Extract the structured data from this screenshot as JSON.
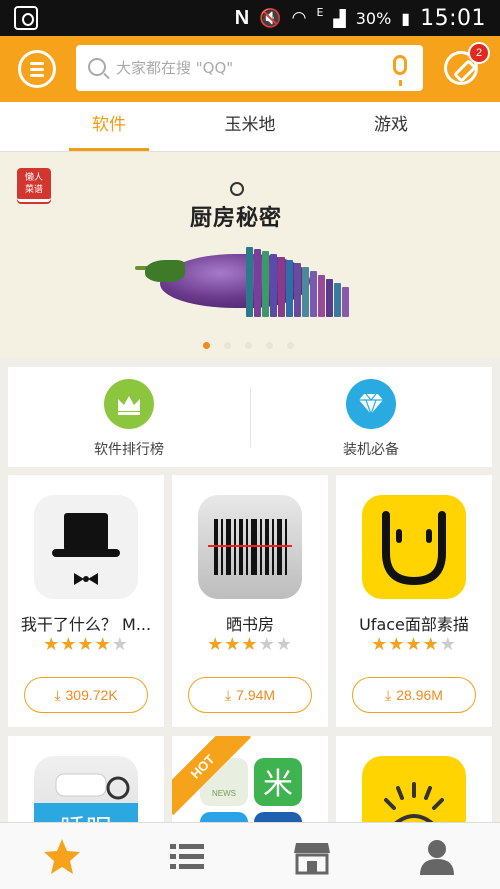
{
  "status_bar": {
    "battery": "30%",
    "time": "15:01",
    "network": "E"
  },
  "header": {
    "search_placeholder": "大家都在搜 \"QQ\"",
    "notification_count": "2"
  },
  "tabs": [
    {
      "label": "软件",
      "active": true
    },
    {
      "label": "玉米地",
      "active": false
    },
    {
      "label": "游戏",
      "active": false
    }
  ],
  "banner": {
    "logo_text": "懒人菜谱",
    "title": "厨房秘密",
    "slide_count": 5,
    "active_slide": 1
  },
  "categories": [
    {
      "label": "软件排行榜",
      "icon": "crown-icon",
      "color": "#8cc63f"
    },
    {
      "label": "装机必备",
      "icon": "diamond-icon",
      "color": "#29abe2"
    }
  ],
  "apps": [
    {
      "name": "我干了什么？ M...",
      "rating": 4,
      "downloads": "309.72K",
      "icon": "tophat-icon"
    },
    {
      "name": "晒书房",
      "rating": 3,
      "downloads": "7.94M",
      "icon": "barcode-icon"
    },
    {
      "name": "Uface面部素描",
      "rating": 4,
      "downloads": "28.96M",
      "icon": "smile-icon"
    }
  ],
  "apps_row2": [
    {
      "name": "",
      "icon": "pillow-icon"
    },
    {
      "name": "",
      "icon": "app-group-icon",
      "ribbon": "HOT"
    },
    {
      "name": "",
      "icon": "sun-icon"
    }
  ],
  "bottom_nav": [
    {
      "label": "featured",
      "icon": "star-icon",
      "active": true
    },
    {
      "label": "categories",
      "icon": "list-icon",
      "active": false
    },
    {
      "label": "store",
      "icon": "store-icon",
      "active": false
    },
    {
      "label": "profile",
      "icon": "person-icon",
      "active": false
    }
  ],
  "colors": {
    "accent": "#f7a21b",
    "badge": "#e5281e"
  }
}
